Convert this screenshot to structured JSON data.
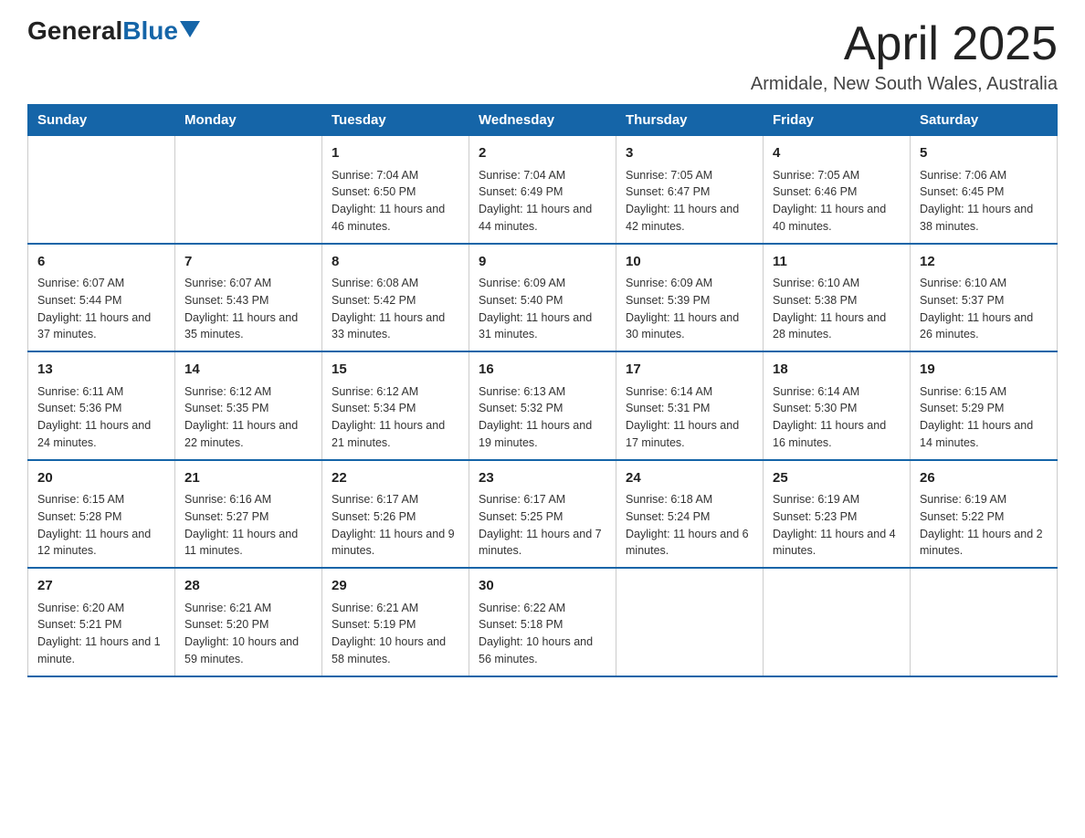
{
  "header": {
    "logo_general": "General",
    "logo_blue": "Blue",
    "title": "April 2025",
    "subtitle": "Armidale, New South Wales, Australia"
  },
  "weekdays": [
    "Sunday",
    "Monday",
    "Tuesday",
    "Wednesday",
    "Thursday",
    "Friday",
    "Saturday"
  ],
  "weeks": [
    [
      {
        "day": "",
        "sunrise": "",
        "sunset": "",
        "daylight": ""
      },
      {
        "day": "",
        "sunrise": "",
        "sunset": "",
        "daylight": ""
      },
      {
        "day": "1",
        "sunrise": "Sunrise: 7:04 AM",
        "sunset": "Sunset: 6:50 PM",
        "daylight": "Daylight: 11 hours and 46 minutes."
      },
      {
        "day": "2",
        "sunrise": "Sunrise: 7:04 AM",
        "sunset": "Sunset: 6:49 PM",
        "daylight": "Daylight: 11 hours and 44 minutes."
      },
      {
        "day": "3",
        "sunrise": "Sunrise: 7:05 AM",
        "sunset": "Sunset: 6:47 PM",
        "daylight": "Daylight: 11 hours and 42 minutes."
      },
      {
        "day": "4",
        "sunrise": "Sunrise: 7:05 AM",
        "sunset": "Sunset: 6:46 PM",
        "daylight": "Daylight: 11 hours and 40 minutes."
      },
      {
        "day": "5",
        "sunrise": "Sunrise: 7:06 AM",
        "sunset": "Sunset: 6:45 PM",
        "daylight": "Daylight: 11 hours and 38 minutes."
      }
    ],
    [
      {
        "day": "6",
        "sunrise": "Sunrise: 6:07 AM",
        "sunset": "Sunset: 5:44 PM",
        "daylight": "Daylight: 11 hours and 37 minutes."
      },
      {
        "day": "7",
        "sunrise": "Sunrise: 6:07 AM",
        "sunset": "Sunset: 5:43 PM",
        "daylight": "Daylight: 11 hours and 35 minutes."
      },
      {
        "day": "8",
        "sunrise": "Sunrise: 6:08 AM",
        "sunset": "Sunset: 5:42 PM",
        "daylight": "Daylight: 11 hours and 33 minutes."
      },
      {
        "day": "9",
        "sunrise": "Sunrise: 6:09 AM",
        "sunset": "Sunset: 5:40 PM",
        "daylight": "Daylight: 11 hours and 31 minutes."
      },
      {
        "day": "10",
        "sunrise": "Sunrise: 6:09 AM",
        "sunset": "Sunset: 5:39 PM",
        "daylight": "Daylight: 11 hours and 30 minutes."
      },
      {
        "day": "11",
        "sunrise": "Sunrise: 6:10 AM",
        "sunset": "Sunset: 5:38 PM",
        "daylight": "Daylight: 11 hours and 28 minutes."
      },
      {
        "day": "12",
        "sunrise": "Sunrise: 6:10 AM",
        "sunset": "Sunset: 5:37 PM",
        "daylight": "Daylight: 11 hours and 26 minutes."
      }
    ],
    [
      {
        "day": "13",
        "sunrise": "Sunrise: 6:11 AM",
        "sunset": "Sunset: 5:36 PM",
        "daylight": "Daylight: 11 hours and 24 minutes."
      },
      {
        "day": "14",
        "sunrise": "Sunrise: 6:12 AM",
        "sunset": "Sunset: 5:35 PM",
        "daylight": "Daylight: 11 hours and 22 minutes."
      },
      {
        "day": "15",
        "sunrise": "Sunrise: 6:12 AM",
        "sunset": "Sunset: 5:34 PM",
        "daylight": "Daylight: 11 hours and 21 minutes."
      },
      {
        "day": "16",
        "sunrise": "Sunrise: 6:13 AM",
        "sunset": "Sunset: 5:32 PM",
        "daylight": "Daylight: 11 hours and 19 minutes."
      },
      {
        "day": "17",
        "sunrise": "Sunrise: 6:14 AM",
        "sunset": "Sunset: 5:31 PM",
        "daylight": "Daylight: 11 hours and 17 minutes."
      },
      {
        "day": "18",
        "sunrise": "Sunrise: 6:14 AM",
        "sunset": "Sunset: 5:30 PM",
        "daylight": "Daylight: 11 hours and 16 minutes."
      },
      {
        "day": "19",
        "sunrise": "Sunrise: 6:15 AM",
        "sunset": "Sunset: 5:29 PM",
        "daylight": "Daylight: 11 hours and 14 minutes."
      }
    ],
    [
      {
        "day": "20",
        "sunrise": "Sunrise: 6:15 AM",
        "sunset": "Sunset: 5:28 PM",
        "daylight": "Daylight: 11 hours and 12 minutes."
      },
      {
        "day": "21",
        "sunrise": "Sunrise: 6:16 AM",
        "sunset": "Sunset: 5:27 PM",
        "daylight": "Daylight: 11 hours and 11 minutes."
      },
      {
        "day": "22",
        "sunrise": "Sunrise: 6:17 AM",
        "sunset": "Sunset: 5:26 PM",
        "daylight": "Daylight: 11 hours and 9 minutes."
      },
      {
        "day": "23",
        "sunrise": "Sunrise: 6:17 AM",
        "sunset": "Sunset: 5:25 PM",
        "daylight": "Daylight: 11 hours and 7 minutes."
      },
      {
        "day": "24",
        "sunrise": "Sunrise: 6:18 AM",
        "sunset": "Sunset: 5:24 PM",
        "daylight": "Daylight: 11 hours and 6 minutes."
      },
      {
        "day": "25",
        "sunrise": "Sunrise: 6:19 AM",
        "sunset": "Sunset: 5:23 PM",
        "daylight": "Daylight: 11 hours and 4 minutes."
      },
      {
        "day": "26",
        "sunrise": "Sunrise: 6:19 AM",
        "sunset": "Sunset: 5:22 PM",
        "daylight": "Daylight: 11 hours and 2 minutes."
      }
    ],
    [
      {
        "day": "27",
        "sunrise": "Sunrise: 6:20 AM",
        "sunset": "Sunset: 5:21 PM",
        "daylight": "Daylight: 11 hours and 1 minute."
      },
      {
        "day": "28",
        "sunrise": "Sunrise: 6:21 AM",
        "sunset": "Sunset: 5:20 PM",
        "daylight": "Daylight: 10 hours and 59 minutes."
      },
      {
        "day": "29",
        "sunrise": "Sunrise: 6:21 AM",
        "sunset": "Sunset: 5:19 PM",
        "daylight": "Daylight: 10 hours and 58 minutes."
      },
      {
        "day": "30",
        "sunrise": "Sunrise: 6:22 AM",
        "sunset": "Sunset: 5:18 PM",
        "daylight": "Daylight: 10 hours and 56 minutes."
      },
      {
        "day": "",
        "sunrise": "",
        "sunset": "",
        "daylight": ""
      },
      {
        "day": "",
        "sunrise": "",
        "sunset": "",
        "daylight": ""
      },
      {
        "day": "",
        "sunrise": "",
        "sunset": "",
        "daylight": ""
      }
    ]
  ]
}
